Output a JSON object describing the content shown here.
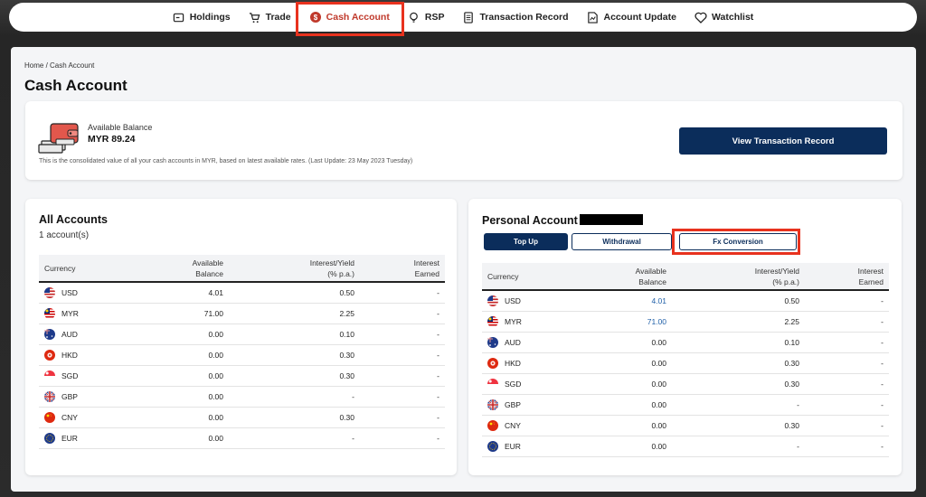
{
  "nav": {
    "items": [
      {
        "label": "Holdings",
        "icon": "holdings-icon"
      },
      {
        "label": "Trade",
        "icon": "cart-icon"
      },
      {
        "label": "Cash Account",
        "icon": "dollar-coin-icon"
      },
      {
        "label": "RSP",
        "icon": "bulb-icon"
      },
      {
        "label": "Transaction Record",
        "icon": "document-icon"
      },
      {
        "label": "Account Update",
        "icon": "chart-file-icon"
      },
      {
        "label": "Watchlist",
        "icon": "heart-icon"
      }
    ],
    "active": "Cash Account"
  },
  "breadcrumb": {
    "home": "Home",
    "sep": " / ",
    "current": "Cash Account"
  },
  "page_title": "Cash Account",
  "balance": {
    "label": "Available Balance",
    "value": "MYR 89.24",
    "note": "This is the consolidated value of all your cash accounts in MYR, based on latest available rates. (Last Update: 23 May 2023 Tuesday)",
    "button": "View Transaction Record"
  },
  "all_accounts": {
    "title": "All Accounts",
    "subtitle": "1 account(s)",
    "headers": {
      "currency": "Currency",
      "balance_1": "Available",
      "balance_2": "Balance",
      "yield_1": "Interest/Yield",
      "yield_2": "(% p.a.)",
      "earned_1": "Interest",
      "earned_2": "Earned"
    },
    "rows": [
      {
        "currency": "USD",
        "balance": "4.01",
        "yield": "0.50",
        "earned": "-"
      },
      {
        "currency": "MYR",
        "balance": "71.00",
        "yield": "2.25",
        "earned": "-"
      },
      {
        "currency": "AUD",
        "balance": "0.00",
        "yield": "0.10",
        "earned": "-"
      },
      {
        "currency": "HKD",
        "balance": "0.00",
        "yield": "0.30",
        "earned": "-"
      },
      {
        "currency": "SGD",
        "balance": "0.00",
        "yield": "0.30",
        "earned": "-"
      },
      {
        "currency": "GBP",
        "balance": "0.00",
        "yield": "-",
        "earned": "-"
      },
      {
        "currency": "CNY",
        "balance": "0.00",
        "yield": "0.30",
        "earned": "-"
      },
      {
        "currency": "EUR",
        "balance": "0.00",
        "yield": "-",
        "earned": "-"
      }
    ]
  },
  "personal": {
    "title": "Personal Account",
    "tabs": {
      "topup": "Top Up",
      "withdrawal": "Withdrawal",
      "fx": "Fx Conversion"
    },
    "headers": {
      "currency": "Currency",
      "balance_1": "Available",
      "balance_2": "Balance",
      "yield_1": "Interest/Yield",
      "yield_2": "(% p.a.)",
      "earned_1": "Interest",
      "earned_2": "Earned"
    },
    "rows": [
      {
        "currency": "USD",
        "balance": "4.01",
        "yield": "0.50",
        "earned": "-"
      },
      {
        "currency": "MYR",
        "balance": "71.00",
        "yield": "2.25",
        "earned": "-"
      },
      {
        "currency": "AUD",
        "balance": "0.00",
        "yield": "0.10",
        "earned": "-"
      },
      {
        "currency": "HKD",
        "balance": "0.00",
        "yield": "0.30",
        "earned": "-"
      },
      {
        "currency": "SGD",
        "balance": "0.00",
        "yield": "0.30",
        "earned": "-"
      },
      {
        "currency": "GBP",
        "balance": "0.00",
        "yield": "-",
        "earned": "-"
      },
      {
        "currency": "CNY",
        "balance": "0.00",
        "yield": "0.30",
        "earned": "-"
      },
      {
        "currency": "EUR",
        "balance": "0.00",
        "yield": "-",
        "earned": "-"
      }
    ]
  },
  "colors": {
    "brand_navy": "#0b2d5b",
    "highlight_red": "#e8321e",
    "link_blue": "#1f5fa8"
  }
}
